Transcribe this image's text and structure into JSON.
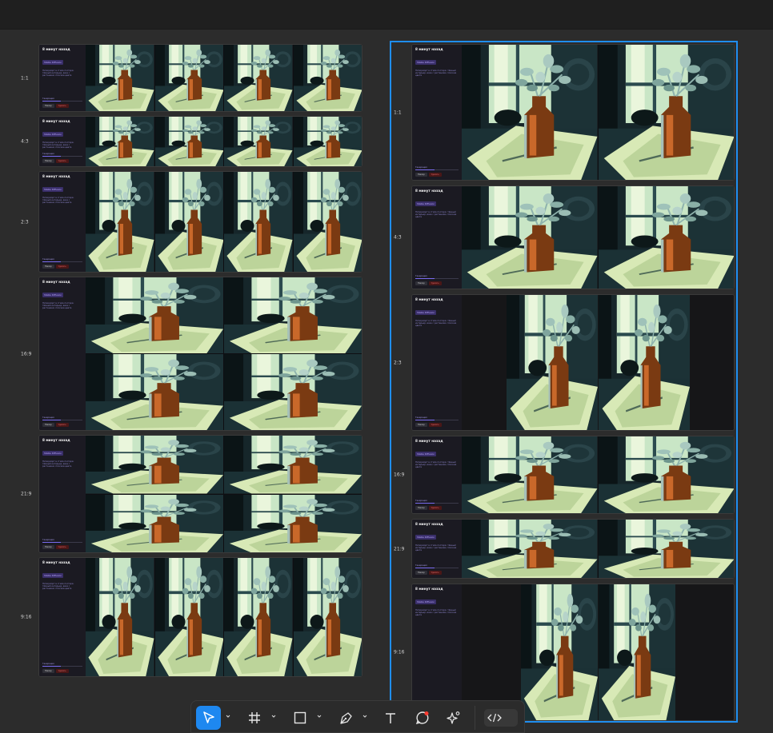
{
  "card": {
    "time": "8 минут назад",
    "model": "Stable Diffusion",
    "description": "Натюрморт в стиле постера: тёмный интерьер, ваза с растением, плоские цвета",
    "progress_label": "Генерация",
    "progress": 0.45,
    "retry_label": "Повтор",
    "delete_label": "Удалить"
  },
  "frames": [
    {
      "id": "left",
      "rows": [
        "1:1",
        "4:3",
        "2:3",
        "16:9",
        "21:9",
        "9:16"
      ]
    },
    {
      "id": "right",
      "rows": [
        "1:1",
        "4:3",
        "2:3",
        "16:9",
        "21:9",
        "9:16"
      ]
    }
  ],
  "toolbar": {
    "tools": [
      {
        "name": "move-tool",
        "icon": "cursor-icon",
        "active": true
      },
      {
        "name": "frame-tool",
        "icon": "frame-icon",
        "active": false
      },
      {
        "name": "shape-tool",
        "icon": "rectangle-icon",
        "active": false
      },
      {
        "name": "pen-tool",
        "icon": "pen-icon",
        "active": false
      },
      {
        "name": "text-tool",
        "icon": "text-icon",
        "active": false
      },
      {
        "name": "comment-tool",
        "icon": "comment-icon",
        "active": false
      },
      {
        "name": "actions-tool",
        "icon": "sparkle-icon",
        "active": false
      },
      {
        "name": "dev-mode-toggle",
        "icon": "code-icon",
        "active": false
      }
    ],
    "accent": "#1e88f0",
    "comment_dot": "#ff3b30"
  },
  "colors": {
    "canvas": "#2c2c2c",
    "selection": "#1f8ef0"
  }
}
